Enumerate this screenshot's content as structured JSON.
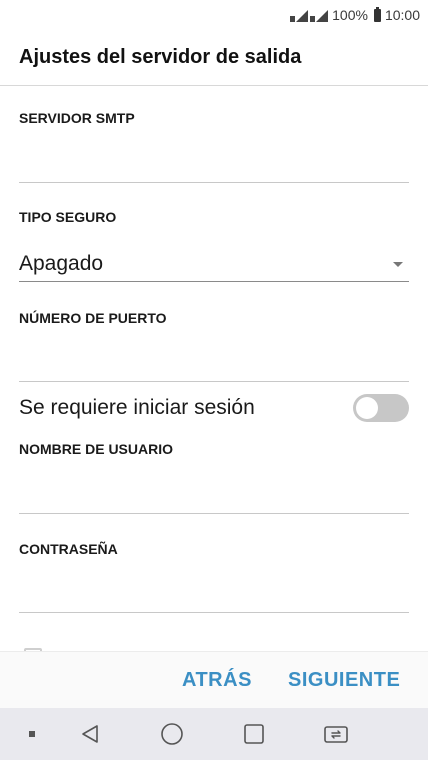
{
  "status_bar": {
    "battery_percent": "100%",
    "time": "10:00"
  },
  "header": {
    "title": "Ajustes del servidor de salida"
  },
  "form": {
    "smtp_server": {
      "label": "SERVIDOR SMTP",
      "value": ""
    },
    "security_type": {
      "label": "TIPO SEGURO",
      "selected": "Apagado"
    },
    "port_number": {
      "label": "NÚMERO DE PUERTO",
      "value": ""
    },
    "require_login": {
      "label": "Se requiere iniciar sesión",
      "enabled": false
    },
    "username": {
      "label": "NOMBRE DE USUARIO",
      "value": ""
    },
    "password": {
      "label": "CONTRASEÑA",
      "value": ""
    }
  },
  "actions": {
    "back_label": "ATRÁS",
    "next_label": "SIGUIENTE"
  },
  "colors": {
    "accent": "#3b8fc4",
    "toggle_off": "#c7c7c7",
    "nav_bar": "#e9e9ee"
  },
  "nav_icons": [
    "square-dot-icon",
    "back-triangle-icon",
    "home-circle-icon",
    "recents-square-icon",
    "dual-window-icon"
  ]
}
